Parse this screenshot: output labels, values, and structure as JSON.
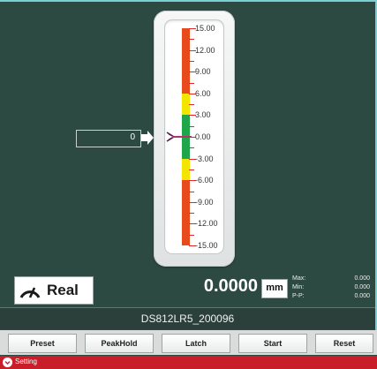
{
  "gauge": {
    "scale_labels": [
      "15.00",
      "12.00",
      "9.00",
      "6.00",
      "3.00",
      "0.00",
      "-3.00",
      "-6.00",
      "-9.00",
      "-12.00",
      "-15.00"
    ],
    "scale_range": [
      -15,
      15
    ],
    "segments": [
      {
        "from": 6,
        "to": 15,
        "color": "#e84a1c"
      },
      {
        "from": 3,
        "to": 6,
        "color": "#f2e600"
      },
      {
        "from": -3,
        "to": 3,
        "color": "#1fa54a"
      },
      {
        "from": -6,
        "to": -3,
        "color": "#f2e600"
      },
      {
        "from": -15,
        "to": -6,
        "color": "#e84a1c"
      }
    ],
    "pointer_value": 0
  },
  "offset_input": {
    "value": "0"
  },
  "mode_button": {
    "label": "Real",
    "icon": "gauge-icon"
  },
  "reading": {
    "value": "0.0000",
    "unit": "mm"
  },
  "stats": [
    {
      "label": "Max:",
      "value": "0.000"
    },
    {
      "label": "Min:",
      "value": "0.000"
    },
    {
      "label": "P-P:",
      "value": "0.000"
    }
  ],
  "device": {
    "name": "DS812LR5_200096"
  },
  "toolbar": {
    "buttons": [
      "Preset",
      "PeakHold",
      "Latch",
      "Start",
      "Reset"
    ]
  },
  "setting": {
    "label": "Setting",
    "icon": "chevron-down-icon"
  },
  "colors": {
    "background": "#2d4a42",
    "accent": "#7ad0d6",
    "setting_bar": "#c81e2a"
  }
}
